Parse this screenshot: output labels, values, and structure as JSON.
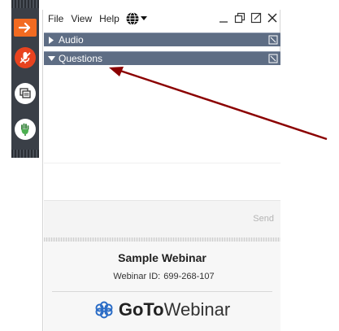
{
  "menubar": {
    "file": "File",
    "view": "View",
    "help": "Help"
  },
  "sections": {
    "audio": "Audio",
    "questions": "Questions"
  },
  "compose": {
    "send_label": "Send"
  },
  "footer": {
    "webinar_title": "Sample Webinar",
    "webinar_id_label": "Webinar ID:",
    "webinar_id_value": "699-268-107",
    "logo_goto": "GoTo",
    "logo_webinar": "Webinar"
  },
  "colors": {
    "accent_orange": "#f26b21",
    "mic_red": "#e8431f",
    "header_blue_gray": "#5e6d84",
    "toolbar_dark": "#3a3f47",
    "hand_green": "#4caf50",
    "arrow_red": "#8b0000",
    "logo_blue": "#2a6cc6"
  },
  "icons": {
    "toolbar": [
      "arrow-right-icon",
      "microphone-muted-icon",
      "screen-share-icon",
      "raise-hand-icon"
    ],
    "menubar": [
      "globe-icon",
      "minimize-icon",
      "detach-icon",
      "popout-icon",
      "close-icon"
    ]
  }
}
